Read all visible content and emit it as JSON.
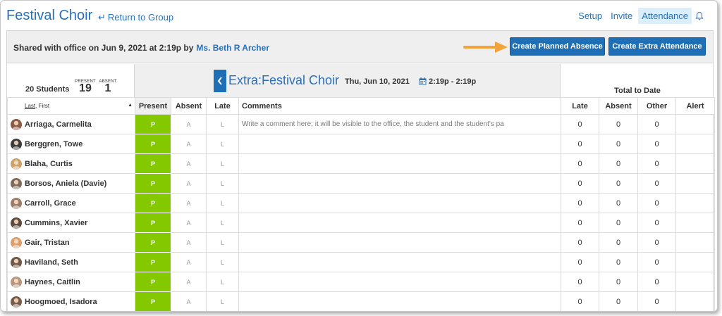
{
  "header": {
    "title": "Festival Choir",
    "return_label": "Return to Group",
    "nav": [
      {
        "label": "Setup",
        "active": false
      },
      {
        "label": "Invite",
        "active": false
      },
      {
        "label": "Attendance",
        "active": true
      }
    ]
  },
  "shared": {
    "text": "Shared with office on Jun 9, 2021 at 2:19p by",
    "by": "Ms. Beth R Archer"
  },
  "buttons": {
    "planned_absence": "Create Planned Absence",
    "extra_attendance": "Create Extra Attendance"
  },
  "summary": {
    "students": "20 Students",
    "present_label": "PRESENT",
    "present_count": "19",
    "absent_label": "ABSENT",
    "absent_count": "1"
  },
  "event": {
    "title": "Extra:Festival Choir",
    "date": "Thu, Jun 10, 2021",
    "time": "2:19p - 2:19p",
    "total_label": "Total to Date"
  },
  "columns": {
    "name_last": "Last",
    "name_first": ", First",
    "present": "Present",
    "absent": "Absent",
    "late": "Late",
    "comments": "Comments",
    "total_late": "Late",
    "total_absent": "Absent",
    "total_other": "Other",
    "alert": "Alert"
  },
  "comment_placeholder": "Write a comment here; it will be visible to the office, the student and the student's pa",
  "rows": [
    {
      "name": "Arriaga, Carmelita",
      "status": "P",
      "a": "A",
      "l": "L",
      "late": "0",
      "absent": "0",
      "other": "0"
    },
    {
      "name": "Berggren, Towe",
      "status": "P",
      "a": "A",
      "l": "L",
      "late": "0",
      "absent": "0",
      "other": "0"
    },
    {
      "name": "Blaha, Curtis",
      "status": "P",
      "a": "A",
      "l": "L",
      "late": "0",
      "absent": "0",
      "other": "0"
    },
    {
      "name": "Borsos, Aniela (Davie)",
      "status": "P",
      "a": "A",
      "l": "L",
      "late": "0",
      "absent": "0",
      "other": "0"
    },
    {
      "name": "Carroll, Grace",
      "status": "P",
      "a": "A",
      "l": "L",
      "late": "0",
      "absent": "0",
      "other": "0"
    },
    {
      "name": "Cummins, Xavier",
      "status": "P",
      "a": "A",
      "l": "L",
      "late": "0",
      "absent": "0",
      "other": "0"
    },
    {
      "name": "Gair, Tristan",
      "status": "P",
      "a": "A",
      "l": "L",
      "late": "0",
      "absent": "0",
      "other": "0"
    },
    {
      "name": "Haviland, Seth",
      "status": "P",
      "a": "A",
      "l": "L",
      "late": "0",
      "absent": "0",
      "other": "0"
    },
    {
      "name": "Haynes, Caitlin",
      "status": "P",
      "a": "A",
      "l": "L",
      "late": "0",
      "absent": "0",
      "other": "0"
    },
    {
      "name": "Hoogmoed, Isadora",
      "status": "P",
      "a": "A",
      "l": "L",
      "late": "0",
      "absent": "0",
      "other": "0"
    }
  ],
  "colors": {
    "accent": "#1f6fb6",
    "link": "#2a70b8",
    "present_green": "#84c800",
    "pointer_orange": "#f2a33a"
  },
  "icons": {
    "return": "return-arrow-icon",
    "bell": "bell-icon",
    "calendar": "calendar-icon",
    "back": "chevron-left-icon",
    "sort": "sort-up-icon"
  }
}
